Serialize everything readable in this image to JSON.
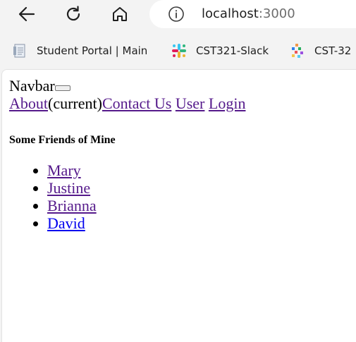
{
  "browser": {
    "back_icon": "back-arrow-icon",
    "reload_icon": "reload-icon",
    "home_icon": "home-icon",
    "info_icon": "info-icon",
    "url_host": "localhost",
    "url_port": ":3000"
  },
  "bookmarks": [
    {
      "label": "Student Portal | Main",
      "icon": "document-icon"
    },
    {
      "label": "CST321-Slack",
      "icon": "slack-icon"
    },
    {
      "label": "CST-32",
      "icon": "multicolor-logo-icon"
    }
  ],
  "page": {
    "navbar_brand": "Navbar",
    "nav_links": {
      "about": "About",
      "current_marker": "(current)",
      "contact": "Contact Us",
      "user": "User",
      "login": "Login"
    },
    "friends_heading": "Some Friends of Mine",
    "friends": [
      {
        "name": "Mary",
        "visited": true
      },
      {
        "name": "Justine",
        "visited": true
      },
      {
        "name": "Brianna",
        "visited": true
      },
      {
        "name": "David",
        "visited": false
      }
    ]
  },
  "colors": {
    "visited_link": "#551a8b",
    "unvisited_link": "#0000ee",
    "chrome_bg": "#f3f3f3"
  }
}
